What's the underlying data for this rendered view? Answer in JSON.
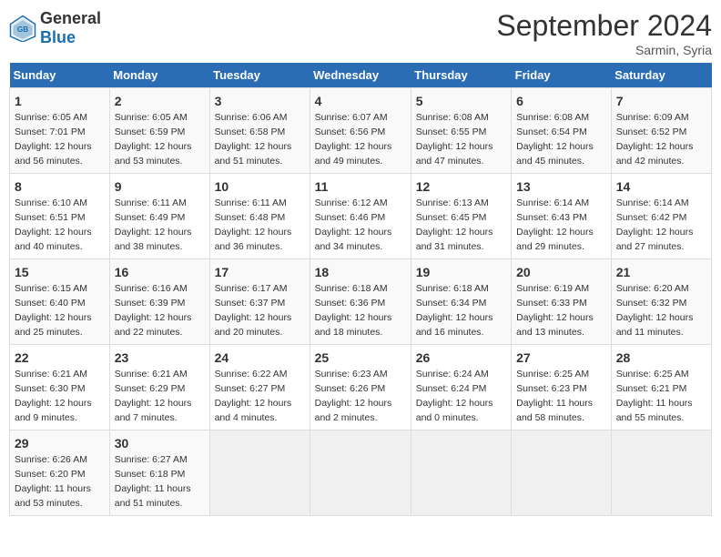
{
  "header": {
    "logo_general": "General",
    "logo_blue": "Blue",
    "month_title": "September 2024",
    "location": "Sarmin, Syria"
  },
  "days_of_week": [
    "Sunday",
    "Monday",
    "Tuesday",
    "Wednesday",
    "Thursday",
    "Friday",
    "Saturday"
  ],
  "weeks": [
    [
      {
        "day": "1",
        "info": "Sunrise: 6:05 AM\nSunset: 7:01 PM\nDaylight: 12 hours\nand 56 minutes."
      },
      {
        "day": "2",
        "info": "Sunrise: 6:05 AM\nSunset: 6:59 PM\nDaylight: 12 hours\nand 53 minutes."
      },
      {
        "day": "3",
        "info": "Sunrise: 6:06 AM\nSunset: 6:58 PM\nDaylight: 12 hours\nand 51 minutes."
      },
      {
        "day": "4",
        "info": "Sunrise: 6:07 AM\nSunset: 6:56 PM\nDaylight: 12 hours\nand 49 minutes."
      },
      {
        "day": "5",
        "info": "Sunrise: 6:08 AM\nSunset: 6:55 PM\nDaylight: 12 hours\nand 47 minutes."
      },
      {
        "day": "6",
        "info": "Sunrise: 6:08 AM\nSunset: 6:54 PM\nDaylight: 12 hours\nand 45 minutes."
      },
      {
        "day": "7",
        "info": "Sunrise: 6:09 AM\nSunset: 6:52 PM\nDaylight: 12 hours\nand 42 minutes."
      }
    ],
    [
      {
        "day": "8",
        "info": "Sunrise: 6:10 AM\nSunset: 6:51 PM\nDaylight: 12 hours\nand 40 minutes."
      },
      {
        "day": "9",
        "info": "Sunrise: 6:11 AM\nSunset: 6:49 PM\nDaylight: 12 hours\nand 38 minutes."
      },
      {
        "day": "10",
        "info": "Sunrise: 6:11 AM\nSunset: 6:48 PM\nDaylight: 12 hours\nand 36 minutes."
      },
      {
        "day": "11",
        "info": "Sunrise: 6:12 AM\nSunset: 6:46 PM\nDaylight: 12 hours\nand 34 minutes."
      },
      {
        "day": "12",
        "info": "Sunrise: 6:13 AM\nSunset: 6:45 PM\nDaylight: 12 hours\nand 31 minutes."
      },
      {
        "day": "13",
        "info": "Sunrise: 6:14 AM\nSunset: 6:43 PM\nDaylight: 12 hours\nand 29 minutes."
      },
      {
        "day": "14",
        "info": "Sunrise: 6:14 AM\nSunset: 6:42 PM\nDaylight: 12 hours\nand 27 minutes."
      }
    ],
    [
      {
        "day": "15",
        "info": "Sunrise: 6:15 AM\nSunset: 6:40 PM\nDaylight: 12 hours\nand 25 minutes."
      },
      {
        "day": "16",
        "info": "Sunrise: 6:16 AM\nSunset: 6:39 PM\nDaylight: 12 hours\nand 22 minutes."
      },
      {
        "day": "17",
        "info": "Sunrise: 6:17 AM\nSunset: 6:37 PM\nDaylight: 12 hours\nand 20 minutes."
      },
      {
        "day": "18",
        "info": "Sunrise: 6:18 AM\nSunset: 6:36 PM\nDaylight: 12 hours\nand 18 minutes."
      },
      {
        "day": "19",
        "info": "Sunrise: 6:18 AM\nSunset: 6:34 PM\nDaylight: 12 hours\nand 16 minutes."
      },
      {
        "day": "20",
        "info": "Sunrise: 6:19 AM\nSunset: 6:33 PM\nDaylight: 12 hours\nand 13 minutes."
      },
      {
        "day": "21",
        "info": "Sunrise: 6:20 AM\nSunset: 6:32 PM\nDaylight: 12 hours\nand 11 minutes."
      }
    ],
    [
      {
        "day": "22",
        "info": "Sunrise: 6:21 AM\nSunset: 6:30 PM\nDaylight: 12 hours\nand 9 minutes."
      },
      {
        "day": "23",
        "info": "Sunrise: 6:21 AM\nSunset: 6:29 PM\nDaylight: 12 hours\nand 7 minutes."
      },
      {
        "day": "24",
        "info": "Sunrise: 6:22 AM\nSunset: 6:27 PM\nDaylight: 12 hours\nand 4 minutes."
      },
      {
        "day": "25",
        "info": "Sunrise: 6:23 AM\nSunset: 6:26 PM\nDaylight: 12 hours\nand 2 minutes."
      },
      {
        "day": "26",
        "info": "Sunrise: 6:24 AM\nSunset: 6:24 PM\nDaylight: 12 hours\nand 0 minutes."
      },
      {
        "day": "27",
        "info": "Sunrise: 6:25 AM\nSunset: 6:23 PM\nDaylight: 11 hours\nand 58 minutes."
      },
      {
        "day": "28",
        "info": "Sunrise: 6:25 AM\nSunset: 6:21 PM\nDaylight: 11 hours\nand 55 minutes."
      }
    ],
    [
      {
        "day": "29",
        "info": "Sunrise: 6:26 AM\nSunset: 6:20 PM\nDaylight: 11 hours\nand 53 minutes."
      },
      {
        "day": "30",
        "info": "Sunrise: 6:27 AM\nSunset: 6:18 PM\nDaylight: 11 hours\nand 51 minutes."
      },
      null,
      null,
      null,
      null,
      null
    ]
  ]
}
